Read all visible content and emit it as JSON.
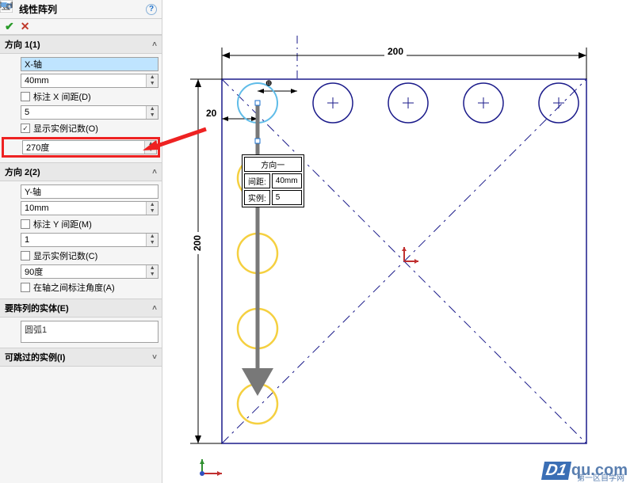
{
  "header": {
    "title": "线性阵列"
  },
  "dir1": {
    "title": "方向 1(1)",
    "axis": "X-轴",
    "spacing": "40mm",
    "dimX": "标注 X 间距(D)",
    "count": "5",
    "showCount": "显示实例记数(O)",
    "angle": "270度"
  },
  "dir2": {
    "title": "方向 2(2)",
    "axis": "Y-轴",
    "spacing": "10mm",
    "dimY": "标注 Y 间距(M)",
    "count": "1",
    "showCount": "显示实例记数(C)",
    "angle": "90度",
    "between": "在轴之间标注角度(A)"
  },
  "entities": {
    "title": "要阵列的实体(E)",
    "item": "圆弧1"
  },
  "skip": {
    "title": "可跳过的实例(I)"
  },
  "canvas": {
    "dim200h": "200",
    "dim200v": "200",
    "dim20": "20",
    "callout": {
      "title": "方向一",
      "spacingLabel": "间距:",
      "spacing": "40mm",
      "countLabel": "实例:",
      "count": "5"
    }
  },
  "watermark": {
    "brand": "D1",
    "domain": "qu.com",
    "sub": "第一区自学网"
  }
}
